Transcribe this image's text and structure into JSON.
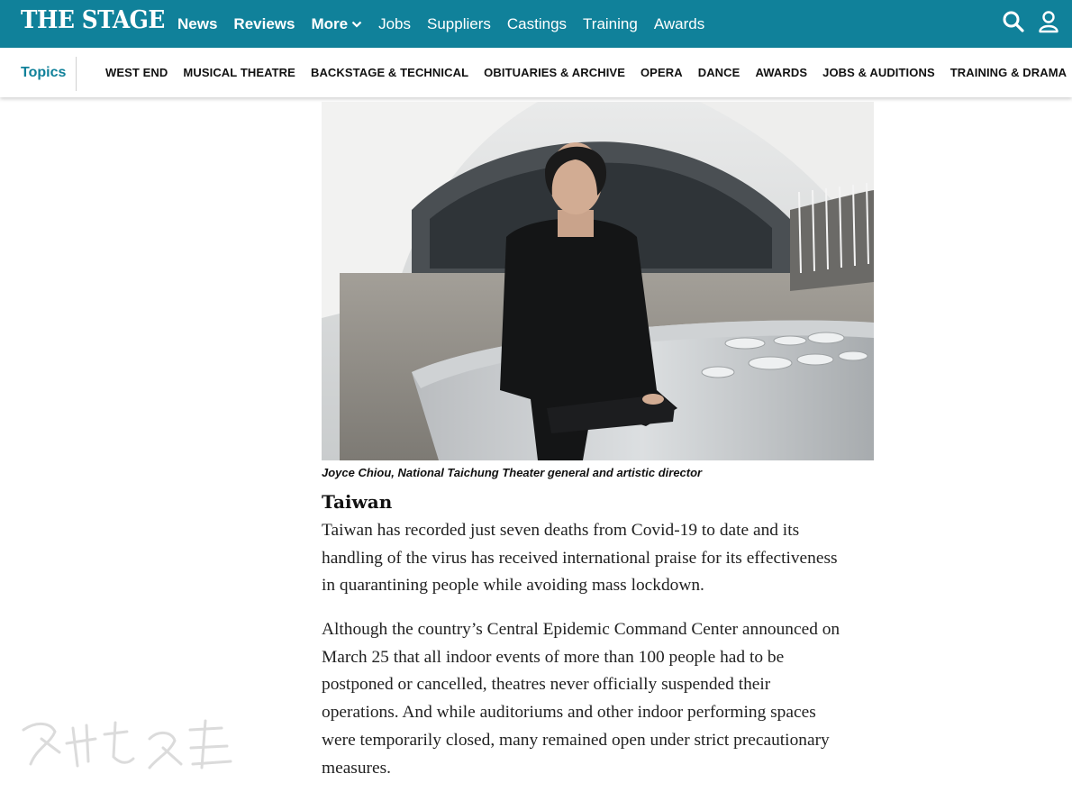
{
  "header": {
    "logo": "THE STAGE",
    "nav": [
      {
        "label": "News",
        "bold": true
      },
      {
        "label": "Reviews",
        "bold": true
      },
      {
        "label": "More",
        "bold": true,
        "has_dropdown": true
      },
      {
        "label": "Jobs",
        "bold": false
      },
      {
        "label": "Suppliers",
        "bold": false
      },
      {
        "label": "Castings",
        "bold": false
      },
      {
        "label": "Training",
        "bold": false
      },
      {
        "label": "Awards",
        "bold": false
      }
    ],
    "icons": [
      "search-icon",
      "user-icon"
    ]
  },
  "topics": {
    "label": "Topics",
    "items": [
      "WEST END",
      "MUSICAL THEATRE",
      "BACKSTAGE & TECHNICAL",
      "OBITUARIES & ARCHIVE",
      "OPERA",
      "DANCE",
      "AWARDS",
      "JOBS & AUDITIONS",
      "TRAINING & DRAMA"
    ]
  },
  "article": {
    "caption": "Joyce Chiou, National Taichung Theater general and artistic director",
    "section_title": "Taiwan",
    "paragraph1": [
      "Taiwan has recorded just seven deaths from Covid-19 to date and its",
      "handling of the virus has received international praise for its effectiveness",
      "in quarantining people while avoiding mass lockdown."
    ],
    "paragraph2": [
      "Although the country’s Central Epidemic Command Center announced on",
      "March 25 that all indoor events of more than 100 people had to be",
      "postponed or cancelled, theatres never officially suspended their",
      "operations. And while auditoriums and other indoor performing spaces",
      "were temporarily closed, many remained open under strict precautionary",
      "measures."
    ]
  },
  "colors": {
    "brand": "#10819a",
    "text": "#222222"
  }
}
